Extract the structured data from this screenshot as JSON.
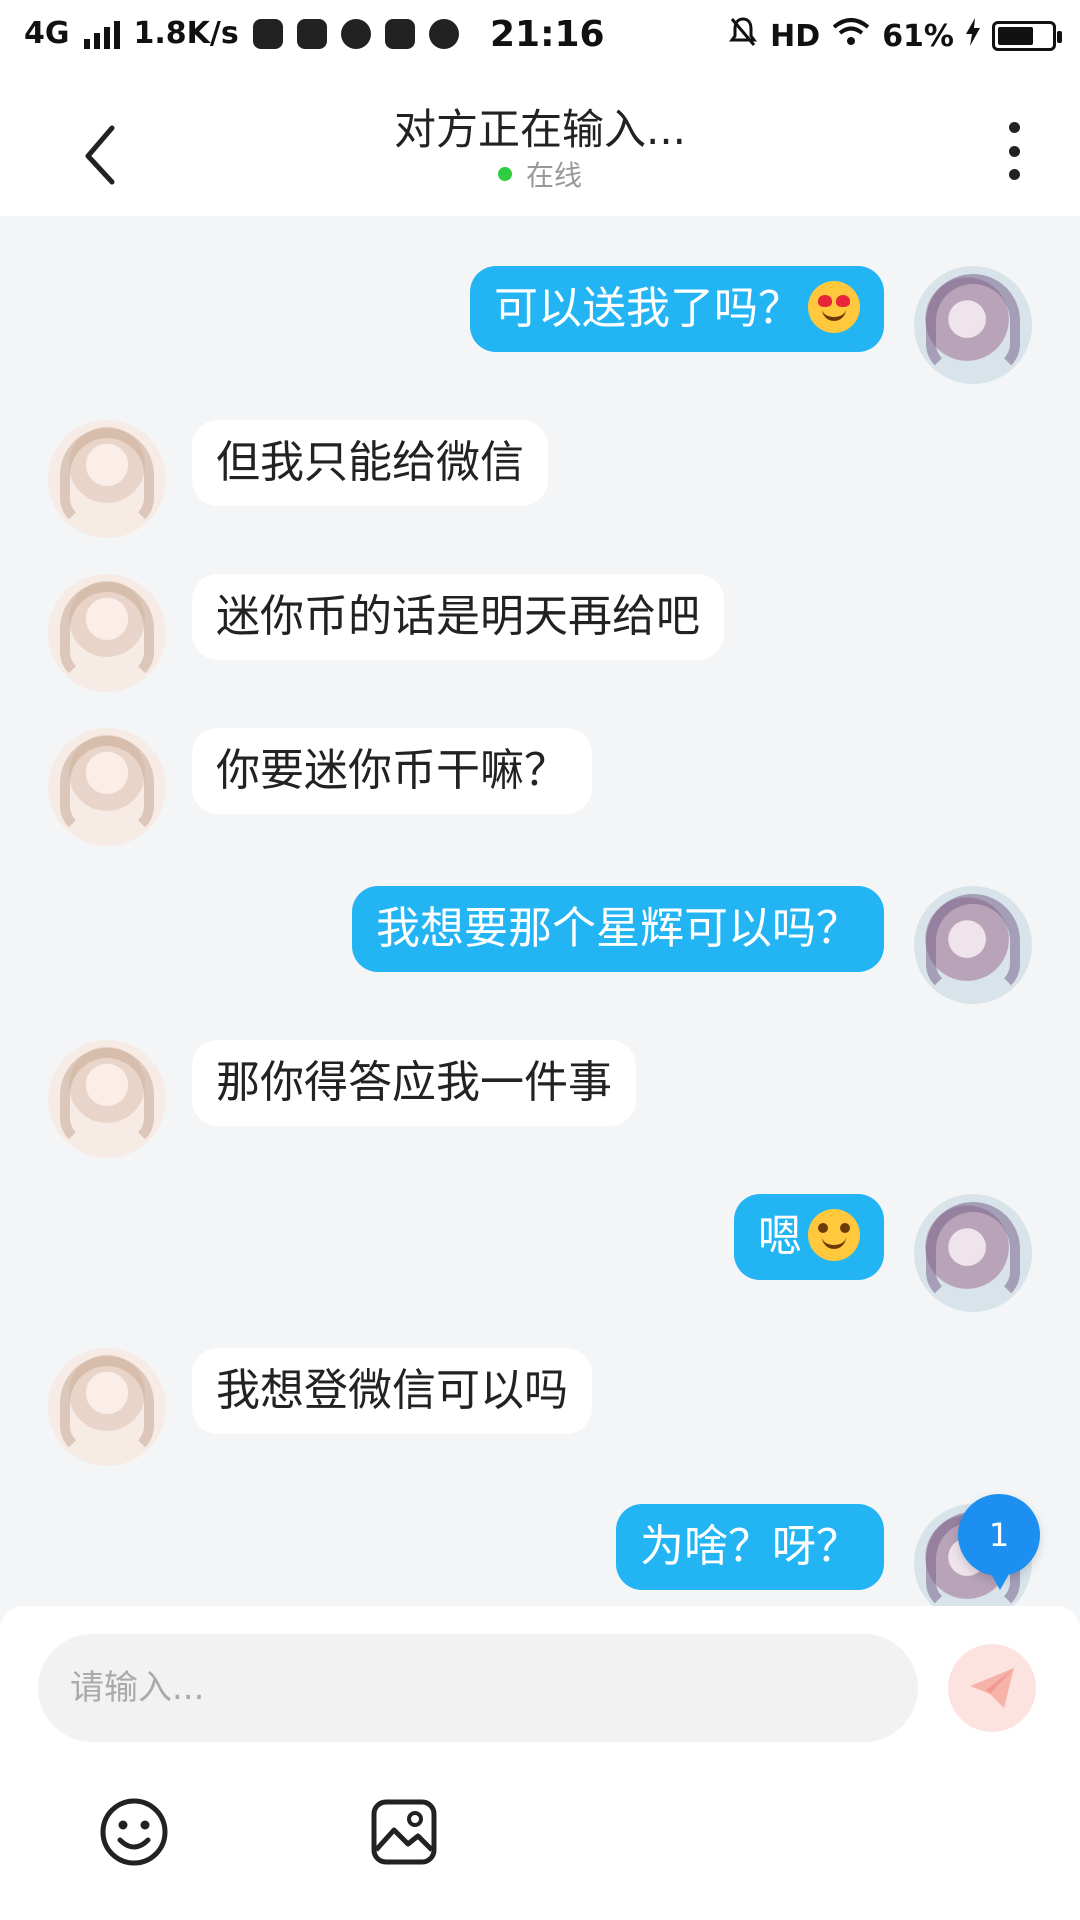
{
  "status_bar": {
    "network": "4G",
    "speed": "1.8K/s",
    "time": "21:16",
    "hd": "HD",
    "battery": "61%",
    "battery_level": 0.61
  },
  "header": {
    "title": "对方正在输入...",
    "status": "在线",
    "status_color": "#2ecc40"
  },
  "messages": [
    {
      "side": "right",
      "text": "可以送我了吗？",
      "emoji": "heart-eyes-emoji"
    },
    {
      "side": "left",
      "text": "但我只能给微信"
    },
    {
      "side": "left",
      "text": "迷你币的话是明天再给吧"
    },
    {
      "side": "left",
      "text": "你要迷你币干嘛？"
    },
    {
      "side": "right",
      "text": "我想要那个星辉可以吗？"
    },
    {
      "side": "left",
      "text": "那你得答应我一件事"
    },
    {
      "side": "right",
      "text": "嗯",
      "emoji": "smiling-emoji"
    },
    {
      "side": "left",
      "text": "我想登微信可以吗"
    },
    {
      "side": "right",
      "text": "为啥？呀？"
    }
  ],
  "unread_badge": "1",
  "input": {
    "placeholder": "请输入..."
  },
  "colors": {
    "outgoing_bubble": "#23b4f4",
    "incoming_bubble": "#ffffff",
    "background": "#f3f5f7",
    "badge": "#1c8ff0"
  },
  "icons": {
    "back": "chevron-left-icon",
    "more": "more-vertical-icon",
    "send": "paper-plane-icon",
    "emoji": "smiley-icon",
    "image": "image-icon"
  }
}
